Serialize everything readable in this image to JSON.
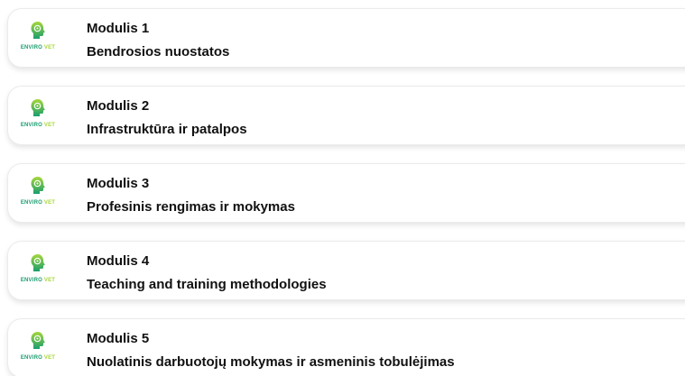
{
  "logo": {
    "word1": "ENVIRO",
    "word2": "VET",
    "icon": "head-with-gears-icon",
    "colors": {
      "primary": "#1a9d6e",
      "secondary": "#a7d63b"
    }
  },
  "modules": [
    {
      "number": "Modulis 1",
      "title": "Bendrosios nuostatos"
    },
    {
      "number": "Modulis 2",
      "title": "Infrastruktūra ir patalpos"
    },
    {
      "number": "Modulis 3",
      "title": "Profesinis rengimas ir mokymas"
    },
    {
      "number": "Modulis 4",
      "title": "Teaching and training methodologies"
    },
    {
      "number": "Modulis 5",
      "title": "Nuolatinis darbuotojų mokymas ir asmeninis tobulėjimas"
    }
  ]
}
